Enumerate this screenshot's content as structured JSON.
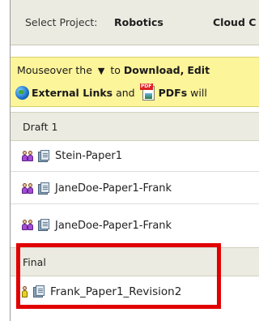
{
  "project_bar": {
    "label": "Select Project:",
    "projects": [
      "Robotics",
      "Cloud C"
    ]
  },
  "notice": {
    "line1_prefix": "Mouseover the",
    "triangle": "▼",
    "line1_to": "to",
    "download": "Download,",
    "edit": "Edit",
    "external_links": "External Links",
    "and": "and",
    "pdfs": "PDFs",
    "will": "will"
  },
  "sections": [
    {
      "title": "Draft 1",
      "items": [
        {
          "name": "Stein-Paper1",
          "icon": "users-icon"
        },
        {
          "name": "JaneDoe-Paper1-Frank",
          "icon": "users-icon"
        },
        {
          "name": "JaneDoe-Paper1-Frank",
          "icon": "users-icon"
        }
      ]
    },
    {
      "title": "Final",
      "items": [
        {
          "name": "Frank_Paper1_Revision2",
          "icon": "user-icon"
        }
      ]
    }
  ],
  "colors": {
    "highlight": "#e10000",
    "notice_bg": "#fdf59a",
    "section_bg": "#ecebe1"
  }
}
